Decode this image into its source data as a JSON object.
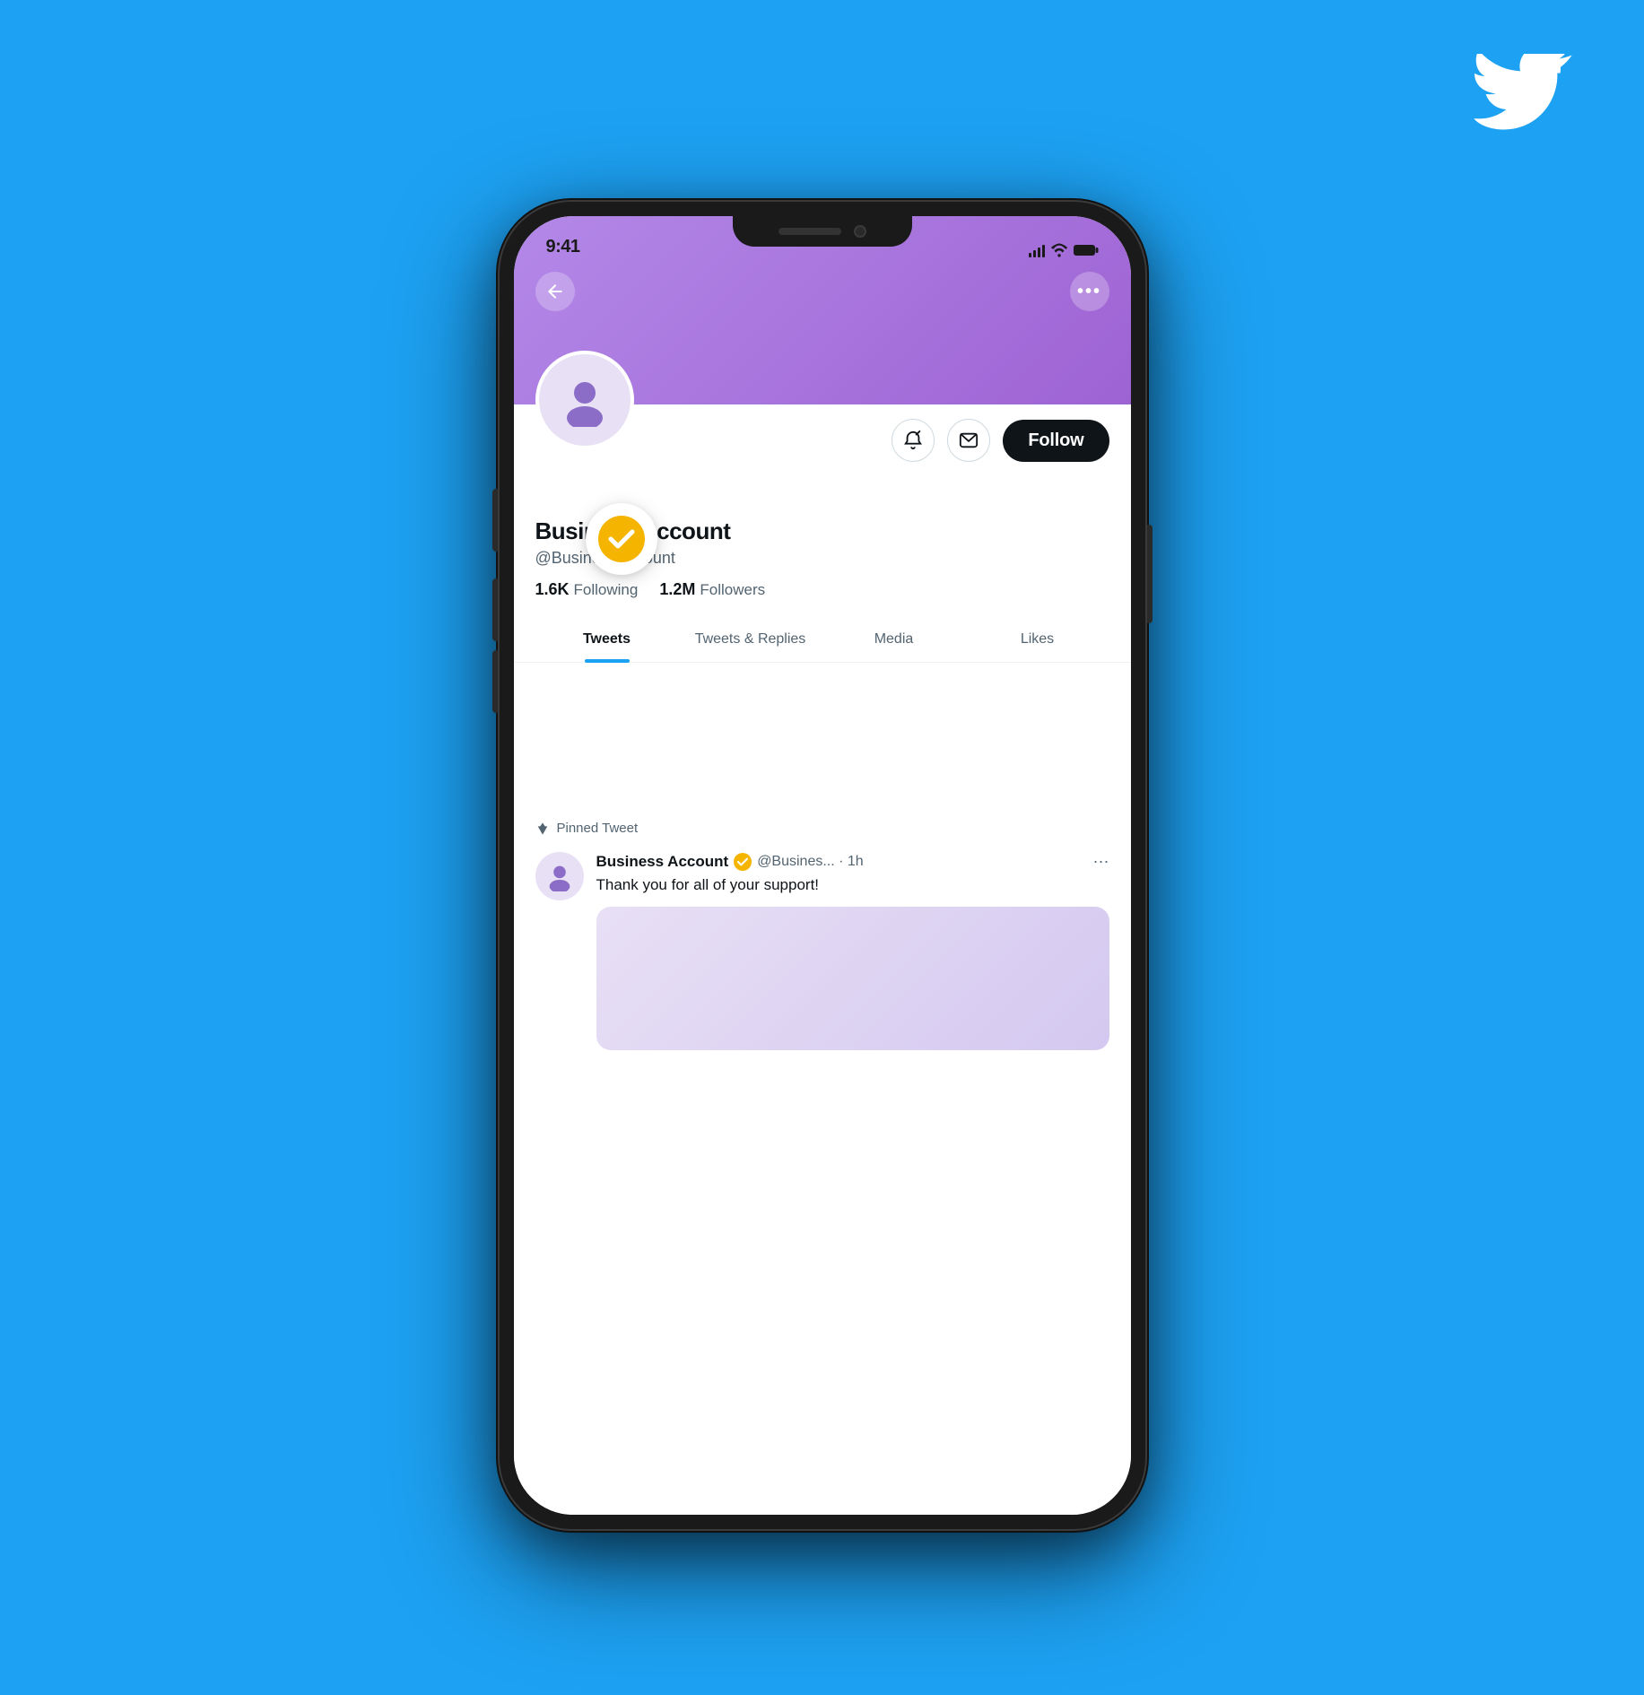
{
  "background": {
    "color": "#1DA1F2"
  },
  "twitter_logo": {
    "alt": "Twitter Bird Logo"
  },
  "status_bar": {
    "time": "9:41",
    "icons": [
      "signal",
      "wifi",
      "battery"
    ]
  },
  "nav": {
    "back_label": "←",
    "more_label": "•••"
  },
  "profile": {
    "name": "Business Account",
    "handle": "@BusinessAccount",
    "following_count": "1.6K",
    "following_label": "Following",
    "followers_count": "1.2M",
    "followers_label": "Followers",
    "follow_button": "Follow",
    "verified": true
  },
  "tabs": [
    {
      "label": "Tweets",
      "active": true
    },
    {
      "label": "Tweets & Replies",
      "active": false
    },
    {
      "label": "Media",
      "active": false
    },
    {
      "label": "Likes",
      "active": false
    }
  ],
  "pinned_tweet": {
    "pin_label": "Pinned Tweet",
    "author": "Business Account",
    "handle_time": "@Busines... · 1h",
    "text": "Thank you for all of your support!",
    "more": "···"
  }
}
